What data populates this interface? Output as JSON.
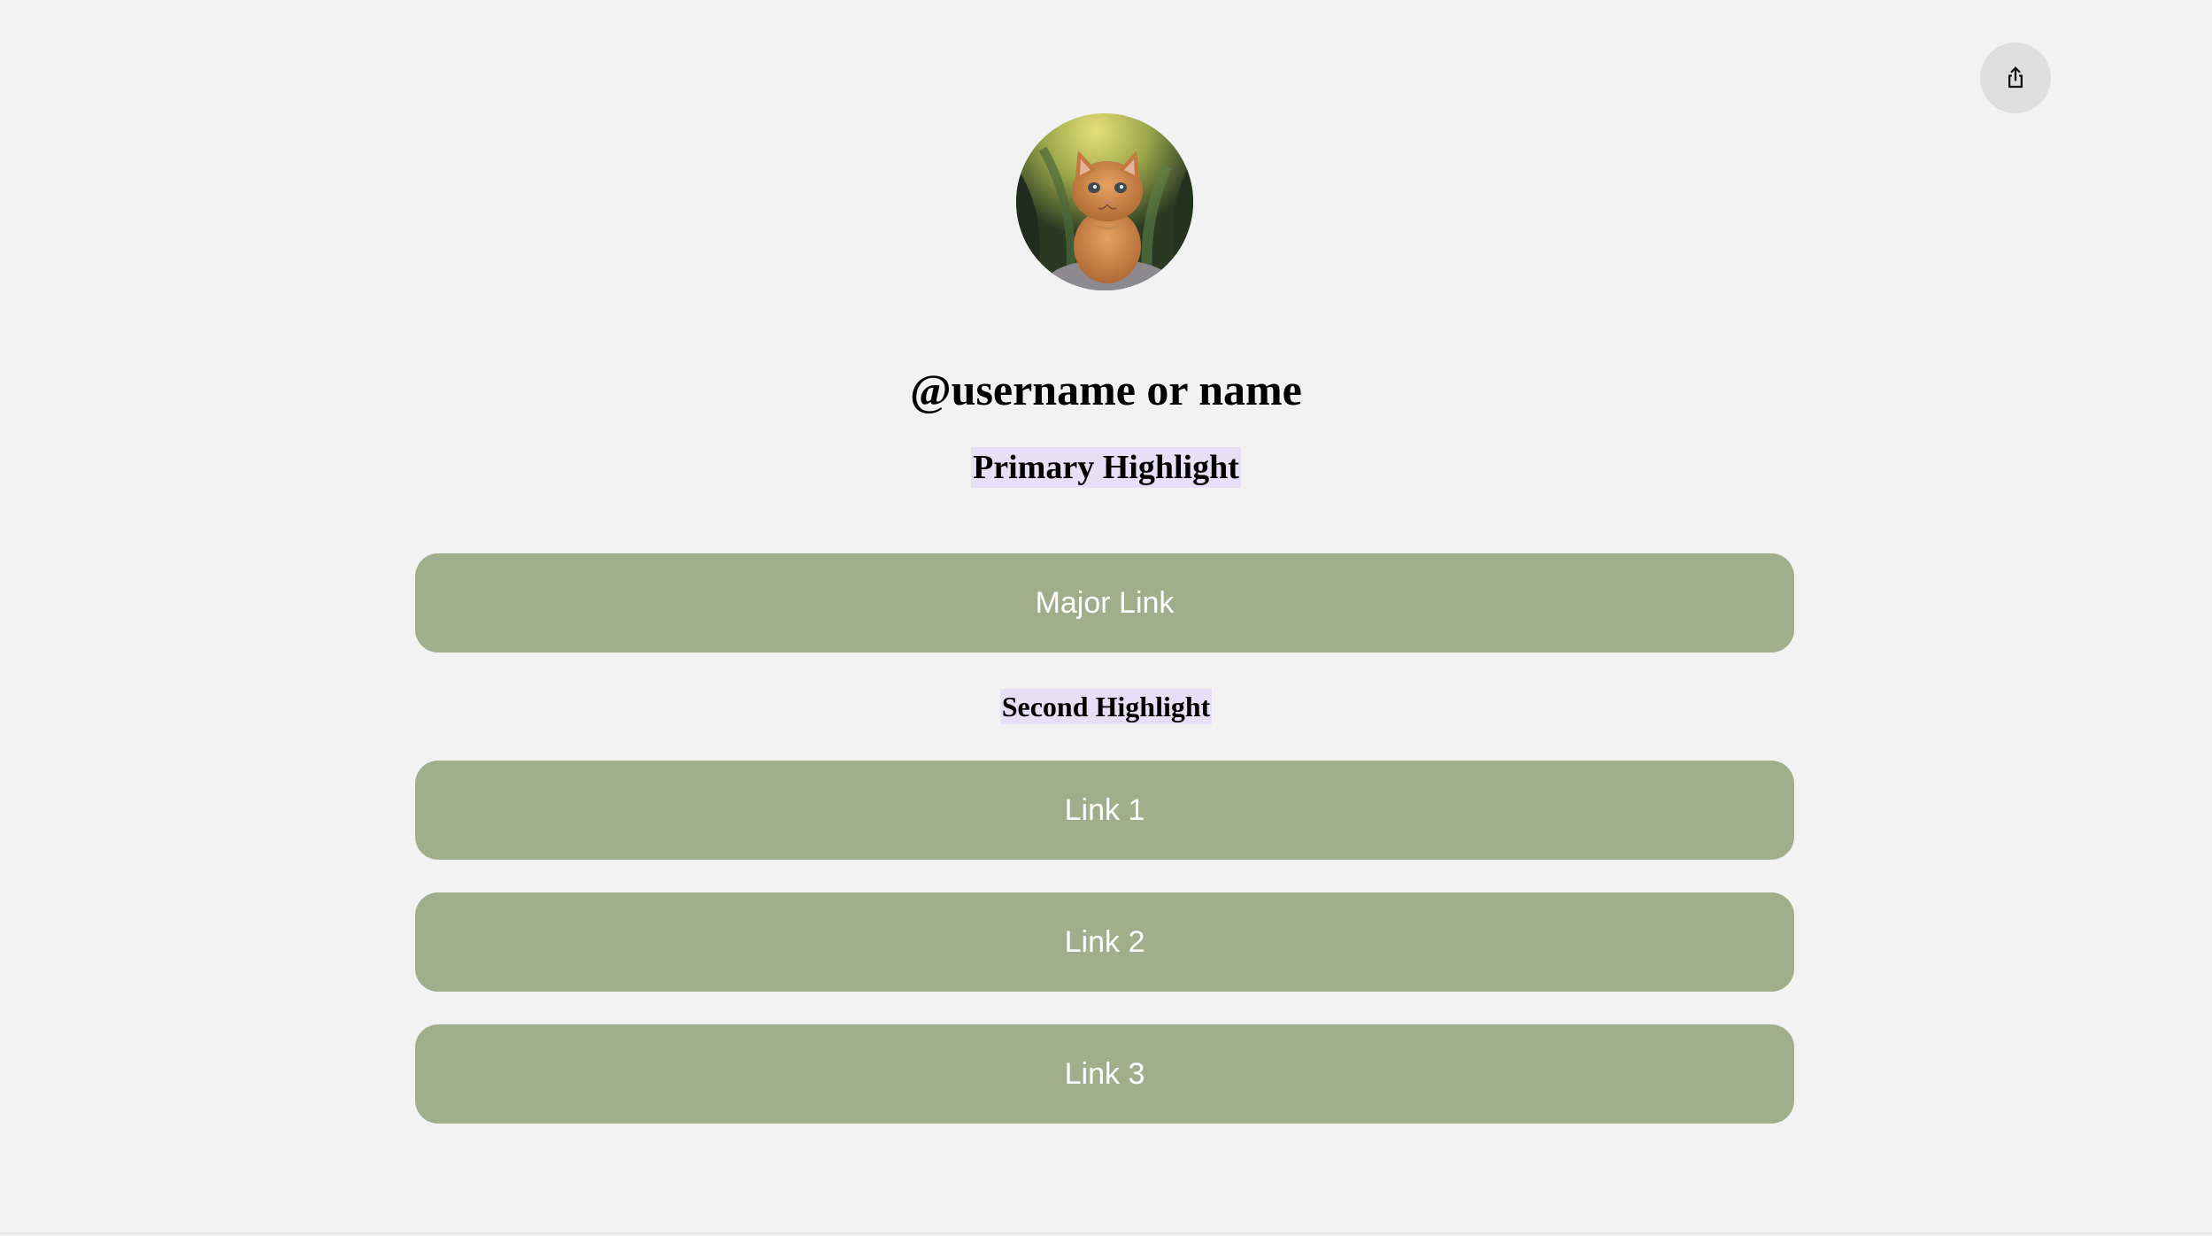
{
  "profile": {
    "username": "@username or name",
    "avatar_icon": "kitten-avatar"
  },
  "share": {
    "icon": "share-icon"
  },
  "highlights": {
    "primary": "Primary Highlight",
    "second": "Second Highlight"
  },
  "links": {
    "major": "Major Link",
    "items": [
      {
        "label": "Link 1"
      },
      {
        "label": "Link 2"
      },
      {
        "label": "Link 3"
      }
    ]
  },
  "colors": {
    "background": "#f2f2f2",
    "button": "#a1ae8b",
    "button_text": "#ffffff",
    "highlight_bg": "#e6dff5",
    "share_bg": "#dedede"
  }
}
